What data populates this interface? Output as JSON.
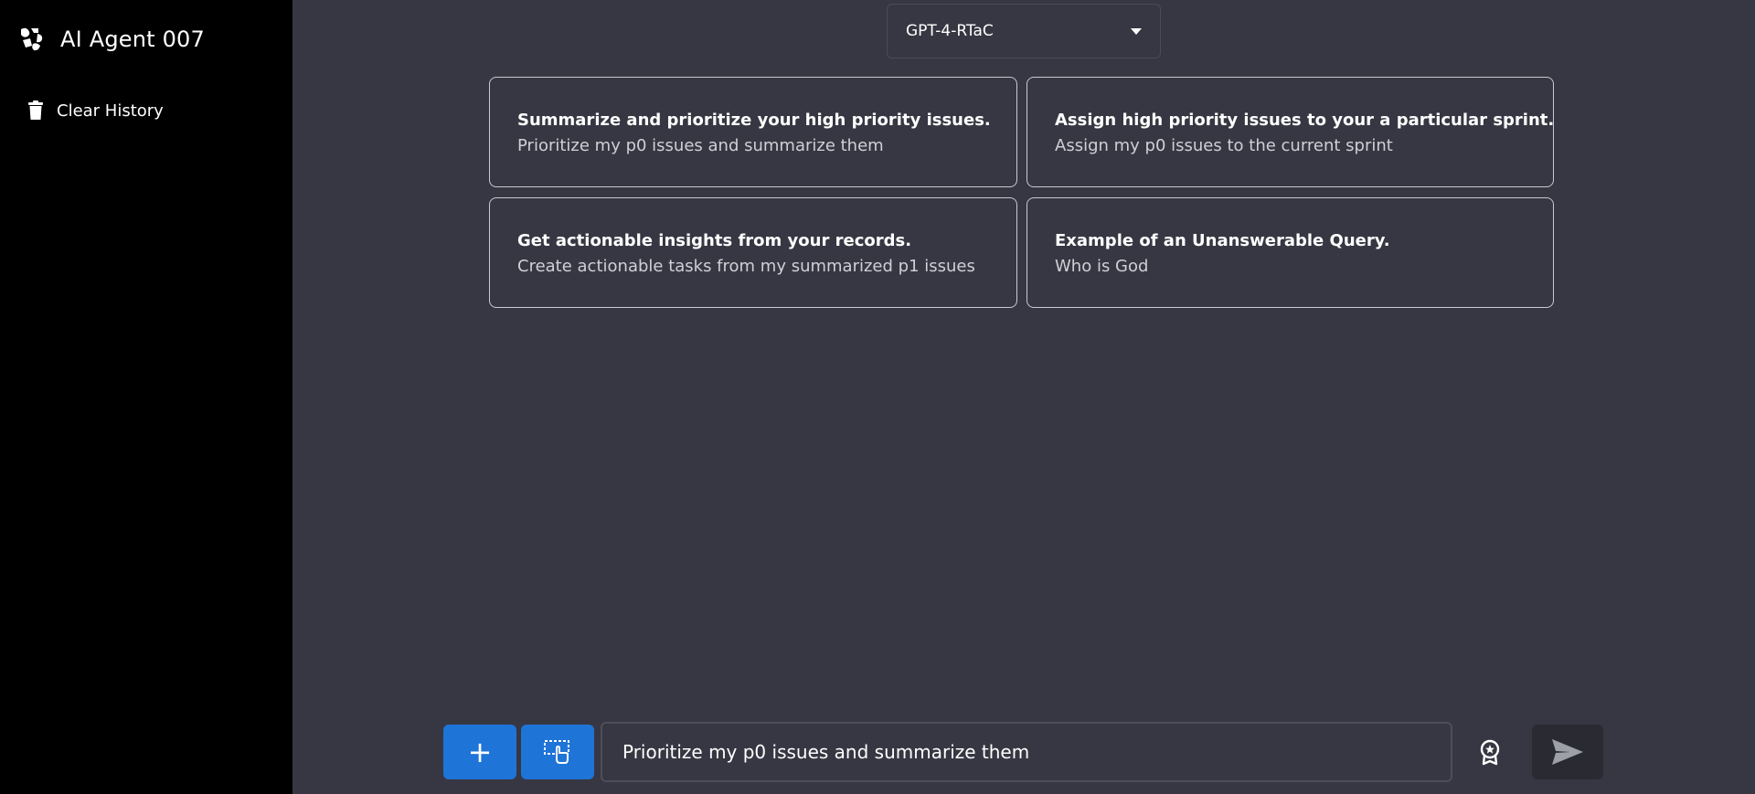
{
  "sidebar": {
    "app_title": "AI Agent 007",
    "logo_icon": "agent-logo-icon",
    "clear_history_label": "Clear History",
    "clear_history_icon": "trash-icon"
  },
  "model_selector": {
    "value": "GPT-4-RTaC",
    "icon": "caret-down-icon"
  },
  "suggestions": [
    {
      "title": "Summarize and prioritize your high priority issues.",
      "subtitle": "Prioritize my p0 issues and summarize them"
    },
    {
      "title": "Assign high priority issues to your a particular sprint.",
      "subtitle": "Assign my p0 issues to the current sprint"
    },
    {
      "title": "Get actionable insights from your records.",
      "subtitle": "Create actionable tasks from my summarized p1 issues"
    },
    {
      "title": "Example of an Unanswerable Query.",
      "subtitle": "Who is God"
    }
  ],
  "composer": {
    "input_value": "Prioritize my p0 issues and summarize them",
    "add_icon": "plus-icon",
    "select_icon": "selection-pointer-icon",
    "badge_icon": "award-badge-icon",
    "send_icon": "send-icon"
  },
  "colors": {
    "main_bg": "#373743",
    "sidebar_bg": "#000000",
    "accent_blue": "#1f74d8",
    "send_bg": "#2a2a33"
  }
}
